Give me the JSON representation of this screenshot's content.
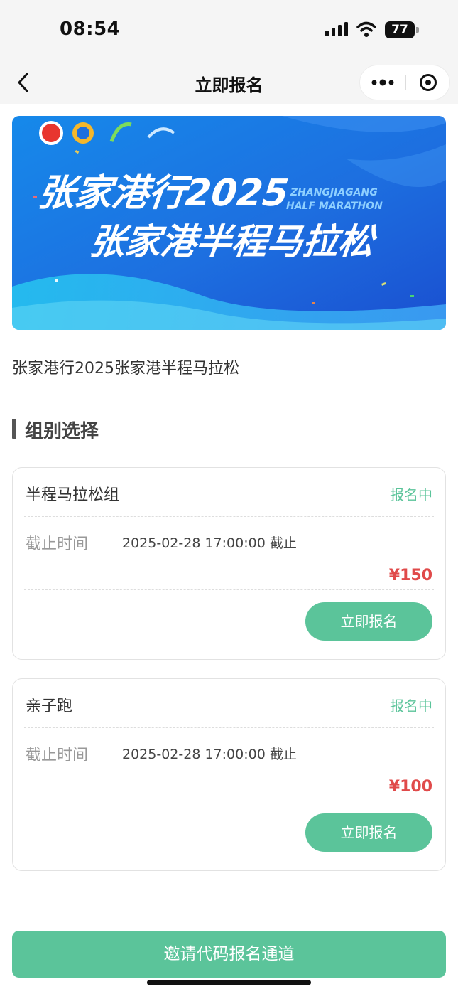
{
  "status_bar": {
    "time": "08:54",
    "battery": "77"
  },
  "nav": {
    "title": "立即报名"
  },
  "banner": {
    "title_line1": "张家港行2025",
    "title_line2": "张家港半程马拉松",
    "en_line1": "ZHANGJIAGANG",
    "en_line2": "HALF MARATHON"
  },
  "event": {
    "title": "张家港行2025张家港半程马拉松"
  },
  "section": {
    "title": "组别选择"
  },
  "groups": [
    {
      "name": "半程马拉松组",
      "status": "报名中",
      "deadline_label": "截止时间",
      "deadline": "2025-02-28 17:00:00 截止",
      "price": "¥150",
      "button": "立即报名"
    },
    {
      "name": "亲子跑",
      "status": "报名中",
      "deadline_label": "截止时间",
      "deadline": "2025-02-28 17:00:00 截止",
      "price": "¥100",
      "button": "立即报名"
    }
  ],
  "invite_button": "邀请代码报名通道",
  "colors": {
    "accent": "#5bc49a",
    "price": "#e04a4a",
    "banner_blue": "#1d6fe0"
  }
}
